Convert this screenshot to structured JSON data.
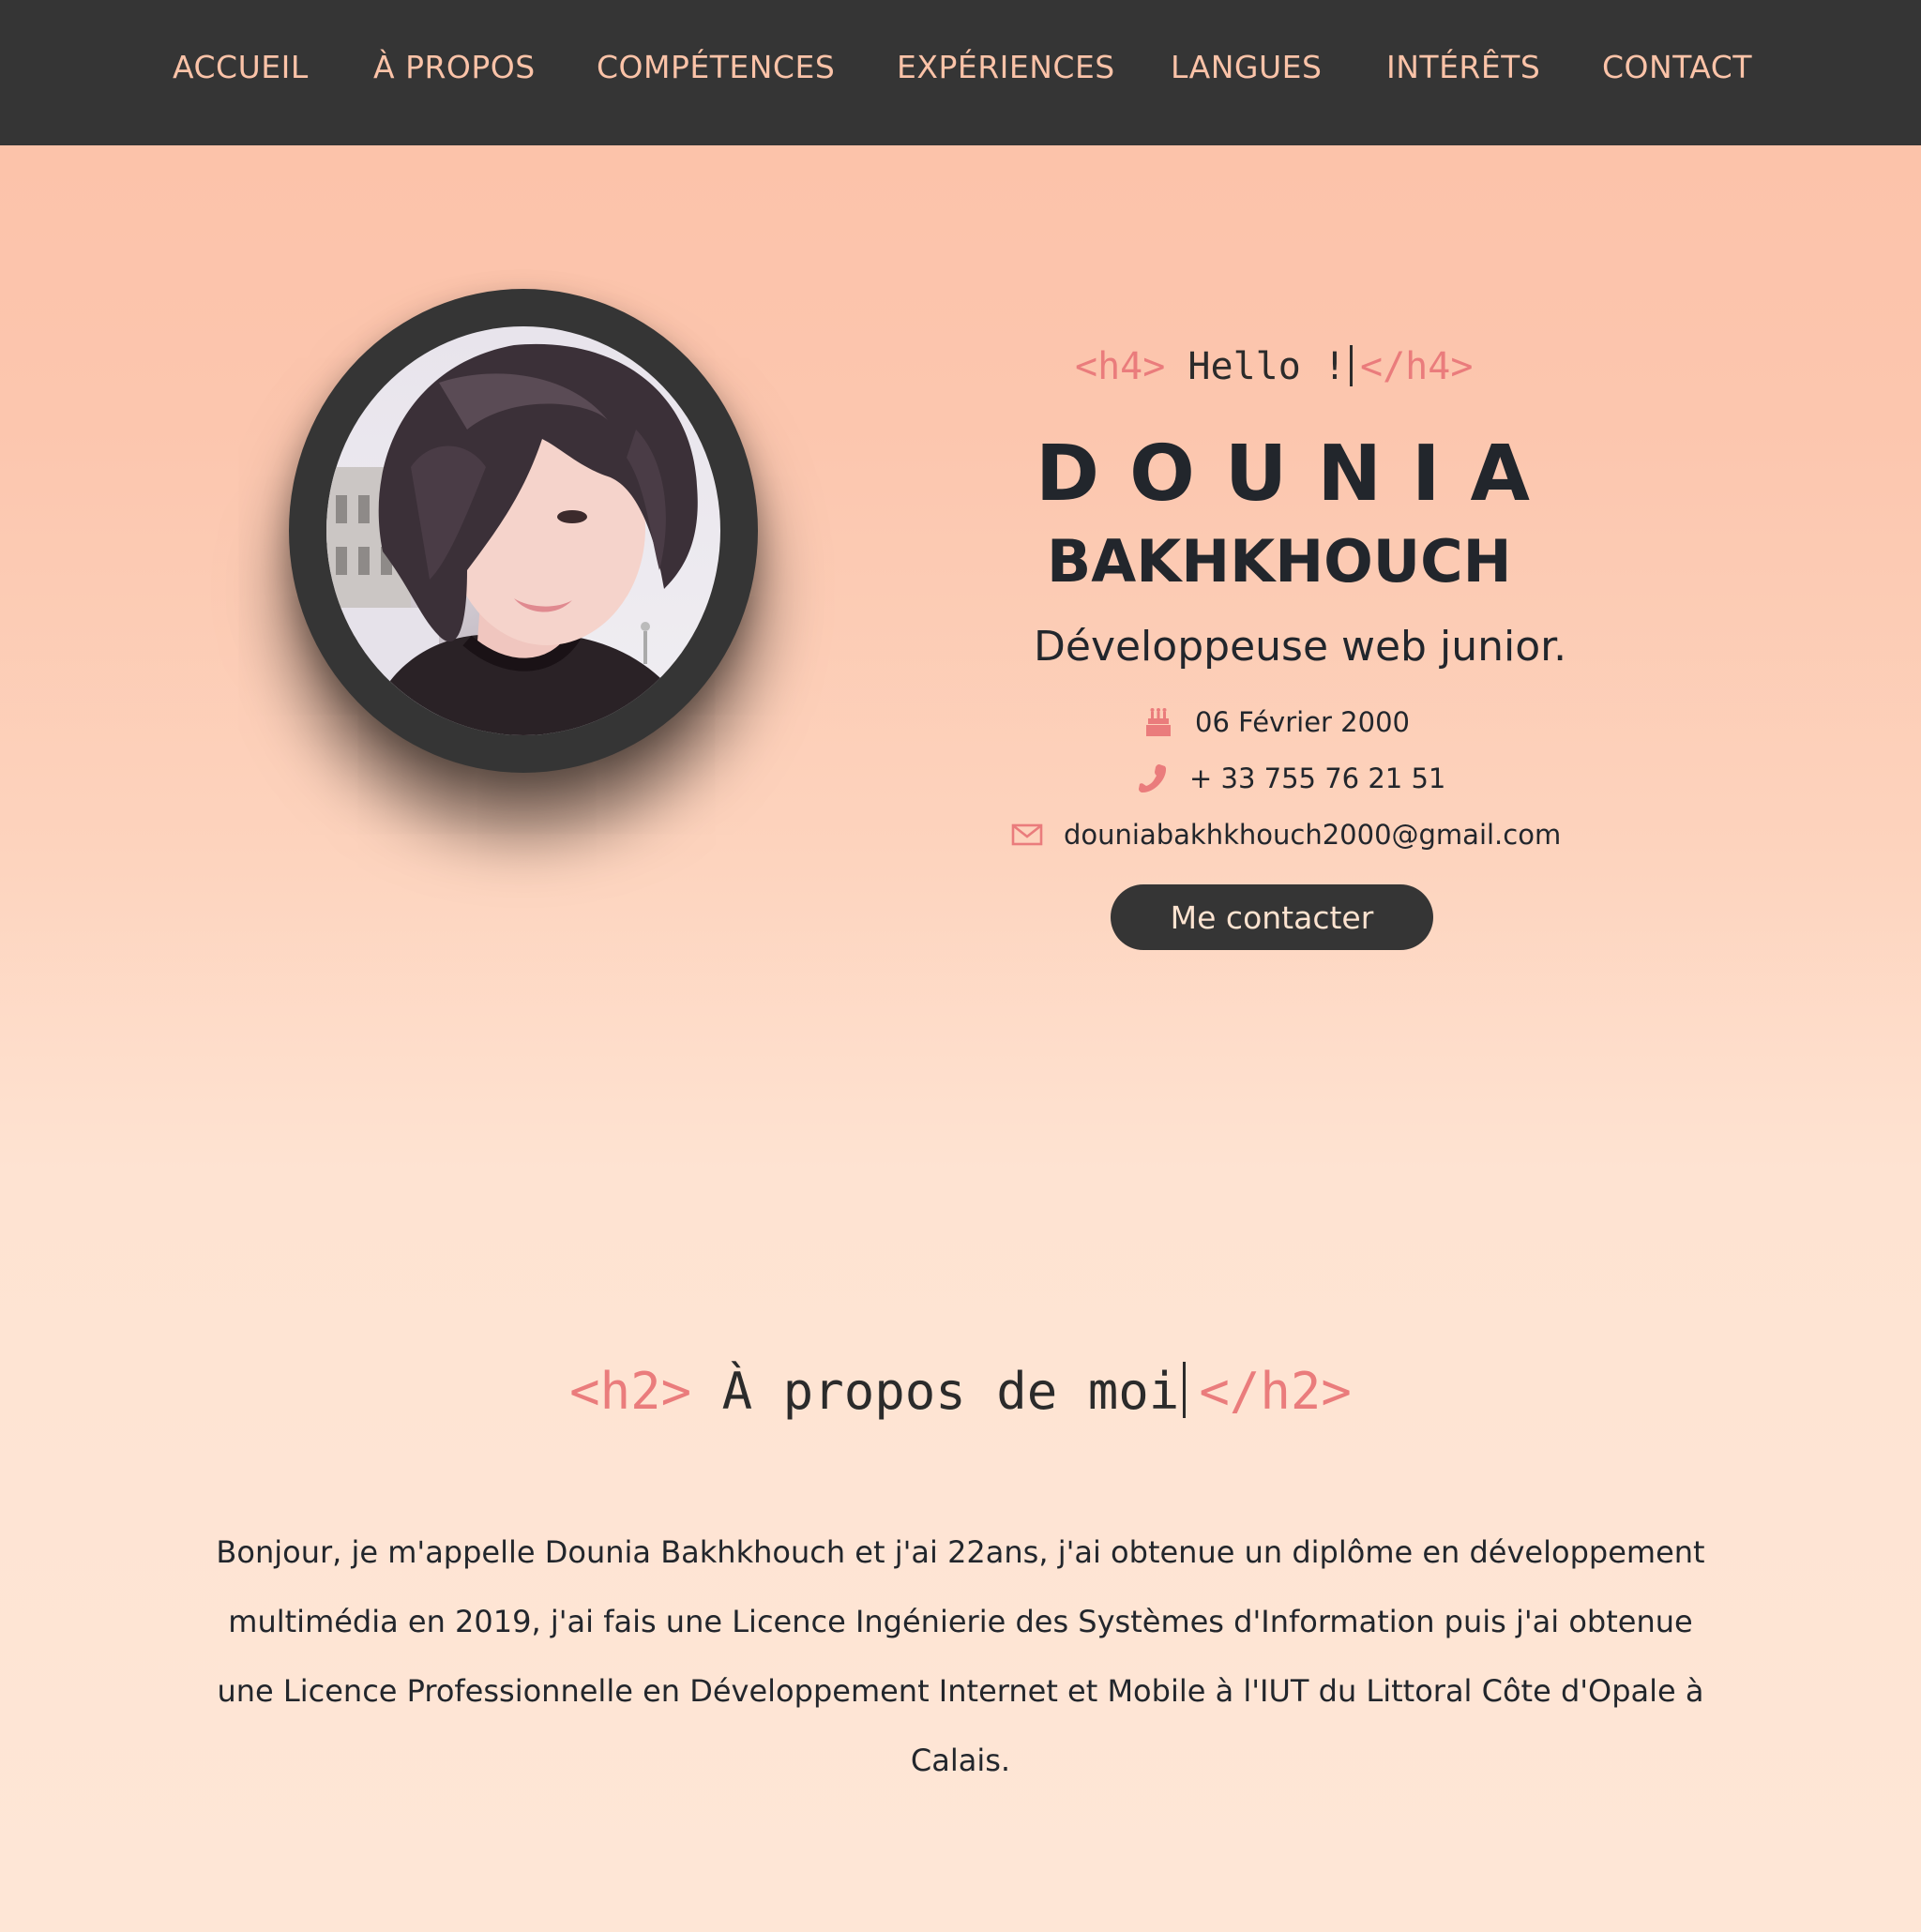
{
  "nav": {
    "items": [
      {
        "label": "ACCUEIL"
      },
      {
        "label": "À PROPOS"
      },
      {
        "label": "COMPÉTENCES"
      },
      {
        "label": "EXPÉRIENCES"
      },
      {
        "label": "LANGUES"
      },
      {
        "label": "INTÉRÊTS"
      },
      {
        "label": "CONTACT"
      }
    ]
  },
  "hero": {
    "hello_open": "<h4>",
    "hello_text": "Hello !",
    "hello_close": "</h4>",
    "first_name": "DOUNIA",
    "last_name": "BAKHKHOUCH",
    "job_title": "Développeuse web junior.",
    "birthday": "06 Février 2000",
    "phone": "+ 33 755 76 21 51",
    "email": "douniabakhkhouch2000@gmail.com",
    "contact_button": "Me contacter"
  },
  "about": {
    "title_open": "<h2>",
    "title_text": "À propos de moi",
    "title_close": "</h2>",
    "paragraph": "Bonjour, je m'appelle Dounia Bakhkhouch et j'ai 22ans, j'ai obtenue un diplôme en développement multimédia en 2019, j'ai fais une Licence Ingénierie des Systèmes d'Information puis j'ai obtenue une Licence Professionnelle en Développement Internet et Mobile à l'IUT du Littoral Côte d'Opale à Calais."
  },
  "colors": {
    "nav_bg": "#353535",
    "nav_text": "#fbc3a8",
    "accent": "#ea7c7c",
    "text_dark": "#22262c",
    "bg_top": "#fcc1a8",
    "bg_bottom": "#fee6d6"
  },
  "icons": {
    "birthday": "cake-icon",
    "phone": "phone-icon",
    "email": "envelope-icon"
  }
}
